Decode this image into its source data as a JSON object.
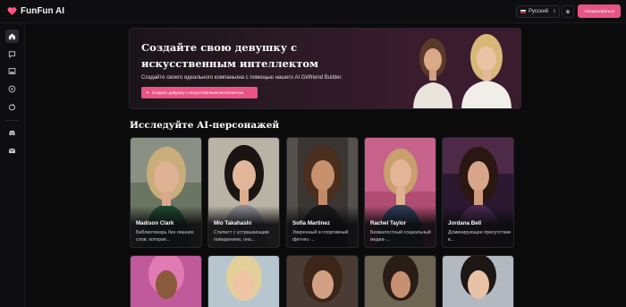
{
  "app": {
    "name": "FunFun AI",
    "logo_icon": "heart-logo-icon"
  },
  "header": {
    "language": {
      "value": "Русский",
      "flag_icon": "russia-flag-icon",
      "chevron_icon": "updown-chevron-icon"
    },
    "theme_icon": "sun-icon",
    "login_label": "Авторизоваться"
  },
  "sidebar": {
    "items": [
      {
        "name": "home",
        "icon": "home-icon",
        "active": true
      },
      {
        "name": "chat",
        "icon": "chat-icon",
        "active": false
      },
      {
        "name": "gallery",
        "icon": "image-icon",
        "active": false
      },
      {
        "name": "explore",
        "icon": "compass-icon",
        "active": false
      },
      {
        "name": "create",
        "icon": "sparkle-icon",
        "active": false
      },
      {
        "name": "discord",
        "icon": "discord-icon",
        "active": false
      },
      {
        "name": "mail",
        "icon": "mail-icon",
        "active": false
      }
    ]
  },
  "hero": {
    "title": "Создайте свою девушку с искусственным интеллектом",
    "subtitle": "Создайте своего идеального компаньона с помощью нашего AI Girlfriend Builder.",
    "button_label": "Создать девушку с искусственным интеллектом",
    "button_icon": "magic-wand-icon"
  },
  "section": {
    "title": "Исследуйте AI-персонажей"
  },
  "characters": [
    {
      "name": "Madison Clark",
      "desc": "Библиотекарь без лишних слов, которая..."
    },
    {
      "name": "Mio Takahashi",
      "desc": "Стилист с устрашающим поведением, она..."
    },
    {
      "name": "Sofia Martinez",
      "desc": "Уверенный и спортивный фитнес-..."
    },
    {
      "name": "Rachel Taylor",
      "desc": "Безжалостный социальный медиа-..."
    },
    {
      "name": "Jordana Bell",
      "desc": "Доминирующее присутствие в..."
    }
  ],
  "colors": {
    "accent": "#e85585",
    "background": "#0b0b0c",
    "panel": "#0e0e10"
  }
}
